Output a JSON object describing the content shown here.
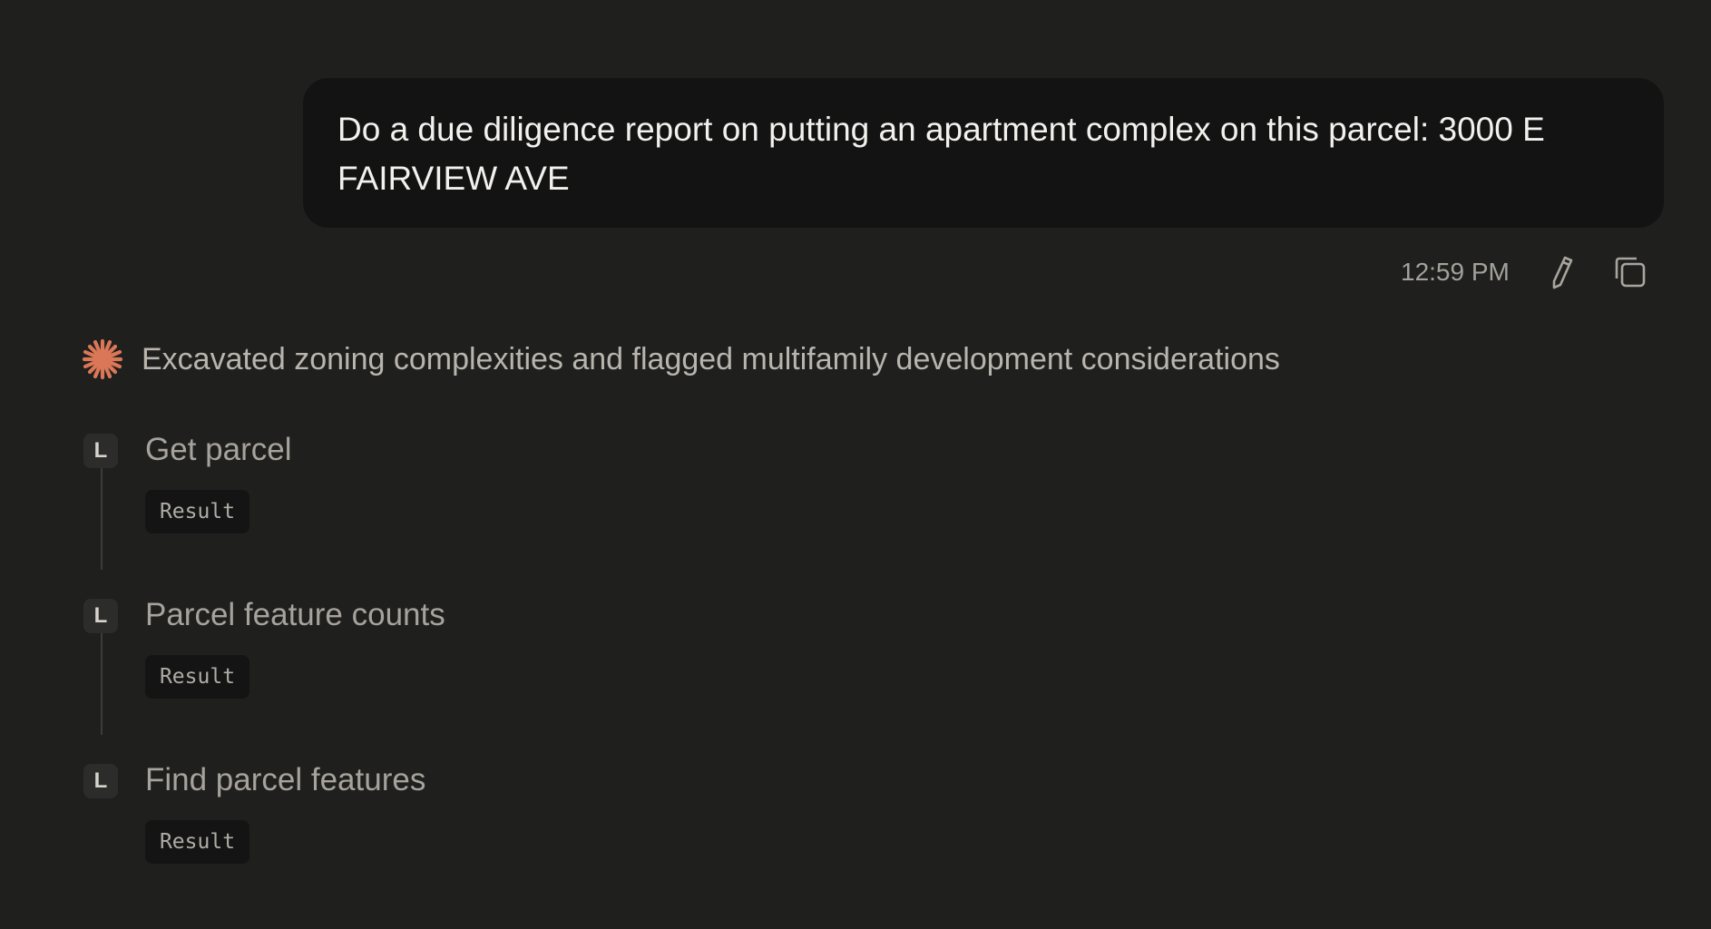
{
  "user_message": {
    "text": "Do a due diligence report on putting an apartment complex on this parcel: 3000 E FAIRVIEW AVE",
    "timestamp": "12:59 PM"
  },
  "icons": {
    "edit": "pencil-icon",
    "copy": "copy-icon",
    "status": "spark-icon"
  },
  "colors": {
    "background": "#1f1f1e",
    "bubble": "#131313",
    "accent": "#d97757"
  },
  "assistant": {
    "status_text": "Excavated zoning complexities and flagged multifamily development considerations",
    "steps": [
      {
        "badge": "L",
        "label": "Get parcel",
        "result_label": "Result"
      },
      {
        "badge": "L",
        "label": "Parcel feature counts",
        "result_label": "Result"
      },
      {
        "badge": "L",
        "label": "Find parcel features",
        "result_label": "Result"
      }
    ]
  }
}
